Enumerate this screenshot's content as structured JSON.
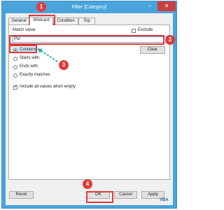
{
  "window": {
    "title": "Filter [Category]",
    "minimize_glyph": "–",
    "close_glyph": "✕"
  },
  "tabs": [
    {
      "label": "General"
    },
    {
      "label": "Wildcard"
    },
    {
      "label": "Condition"
    },
    {
      "label": "Top"
    }
  ],
  "wildcard": {
    "match_value_label": "Match value:",
    "exclude_label": "Exclude",
    "exclude_checked": false,
    "input_value": "Pur",
    "clear_label": "Clear",
    "options": [
      {
        "label": "Contains",
        "selected": true
      },
      {
        "label": "Starts with",
        "selected": false
      },
      {
        "label": "Ends with",
        "selected": false
      },
      {
        "label": "Exactly matches",
        "selected": false
      }
    ],
    "include_all_label": "Include all values when empty",
    "include_all_checked": true
  },
  "buttons": {
    "reset": "Reset",
    "ok": "OK",
    "cancel": "Cancel",
    "apply": "Apply"
  },
  "annotations": {
    "step1": "1",
    "step2": "2",
    "step3": "3",
    "step4": "4",
    "color_red": "#e03b3b",
    "color_arrow": "#2bb3a6"
  },
  "watermark": "VBA"
}
